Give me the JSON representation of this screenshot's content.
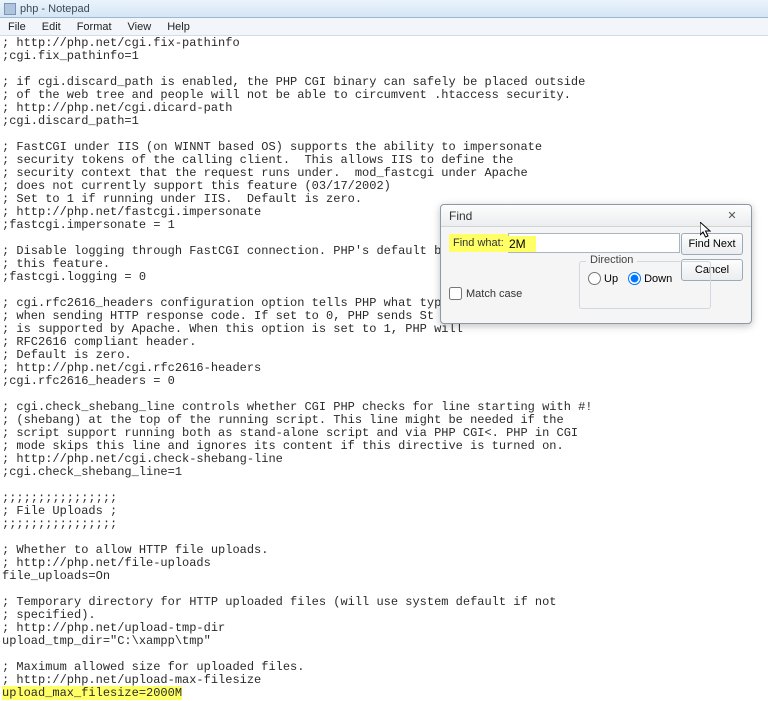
{
  "window": {
    "title": "php - Notepad"
  },
  "menu": {
    "file": "File",
    "edit": "Edit",
    "format": "Format",
    "view": "View",
    "help": "Help"
  },
  "editor_lines": [
    "; http://php.net/cgi.fix-pathinfo",
    ";cgi.fix_pathinfo=1",
    "",
    "; if cgi.discard_path is enabled, the PHP CGI binary can safely be placed outside",
    "; of the web tree and people will not be able to circumvent .htaccess security.",
    "; http://php.net/cgi.dicard-path",
    ";cgi.discard_path=1",
    "",
    "; FastCGI under IIS (on WINNT based OS) supports the ability to impersonate",
    "; security tokens of the calling client.  This allows IIS to define the",
    "; security context that the request runs under.  mod_fastcgi under Apache",
    "; does not currently support this feature (03/17/2002)",
    "; Set to 1 if running under IIS.  Default is zero.",
    "; http://php.net/fastcgi.impersonate",
    ";fastcgi.impersonate = 1",
    "",
    "; Disable logging through FastCGI connection. PHP's default beha",
    "; this feature.",
    ";fastcgi.logging = 0",
    "",
    "; cgi.rfc2616_headers configuration option tells PHP what type o",
    "; when sending HTTP response code. If set to 0, PHP sends St",
    "; is supported by Apache. When this option is set to 1, PHP will",
    "; RFC2616 compliant header.",
    "; Default is zero.",
    "; http://php.net/cgi.rfc2616-headers",
    ";cgi.rfc2616_headers = 0",
    "",
    "; cgi.check_shebang_line controls whether CGI PHP checks for line starting with #!",
    "; (shebang) at the top of the running script. This line might be needed if the",
    "; script support running both as stand-alone script and via PHP CGI<. PHP in CGI",
    "; mode skips this line and ignores its content if this directive is turned on.",
    "; http://php.net/cgi.check-shebang-line",
    ";cgi.check_shebang_line=1",
    "",
    ";;;;;;;;;;;;;;;;",
    "; File Uploads ;",
    ";;;;;;;;;;;;;;;;",
    "",
    "; Whether to allow HTTP file uploads.",
    "; http://php.net/file-uploads",
    "file_uploads=On",
    "",
    "; Temporary directory for HTTP uploaded files (will use system default if not",
    "; specified).",
    "; http://php.net/upload-tmp-dir",
    "upload_tmp_dir=\"C:\\xampp\\tmp\"",
    "",
    "; Maximum allowed size for uploaded files.",
    "; http://php.net/upload-max-filesize"
  ],
  "highlighted_line": "upload_max_filesize=2000M",
  "find_dialog": {
    "title": "Find",
    "find_what_label": "Find what:",
    "find_what_value": "2M",
    "find_next": "Find Next",
    "cancel": "Cancel",
    "direction_label": "Direction",
    "up": "Up",
    "down": "Down",
    "selected_direction": "down",
    "match_case": "Match case",
    "match_case_checked": false
  }
}
